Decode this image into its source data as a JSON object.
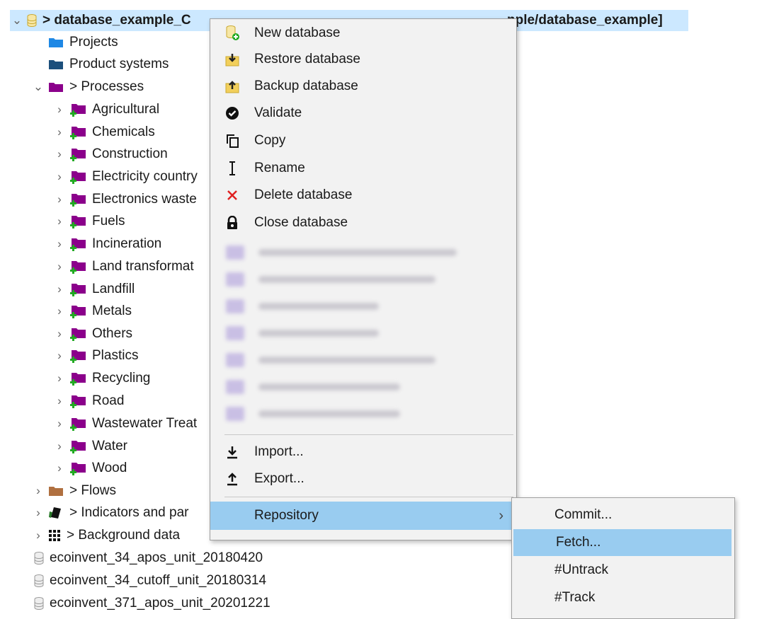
{
  "tree": {
    "root_label": "> database_example_C",
    "root_label_suffix": "nple/database_example]",
    "projects": "Projects",
    "product_systems": "Product systems",
    "processes": "> Processes",
    "process_folders": [
      "Agricultural",
      "Chemicals",
      "Construction",
      "Electricity country",
      "Electronics waste",
      "Fuels",
      "Incineration",
      "Land transformat",
      "Landfill",
      "Metals",
      "Others",
      "Plastics",
      "Recycling",
      "Road",
      "Wastewater Treat",
      "Water",
      "Wood"
    ],
    "flows": "> Flows",
    "indicators": "> Indicators and par",
    "background": "> Background data",
    "databases": [
      "ecoinvent_34_apos_unit_20180420",
      "ecoinvent_34_cutoff_unit_20180314",
      "ecoinvent_371_apos_unit_20201221"
    ]
  },
  "context_menu": {
    "items": [
      {
        "label": "New database",
        "icon": "new-database-icon"
      },
      {
        "label": "Restore database",
        "icon": "restore-icon"
      },
      {
        "label": "Backup database",
        "icon": "backup-icon"
      },
      {
        "label": "Validate",
        "icon": "check-circle-icon"
      },
      {
        "label": "Copy",
        "icon": "copy-icon"
      },
      {
        "label": "Rename",
        "icon": "text-cursor-icon"
      },
      {
        "label": "Delete database",
        "icon": "delete-x-icon"
      },
      {
        "label": "Close database",
        "icon": "lock-icon"
      }
    ],
    "import": "Import...",
    "export": "Export...",
    "repository": "Repository"
  },
  "repository_submenu": {
    "items": [
      "Commit...",
      "Fetch...",
      "#Untrack",
      "#Track"
    ],
    "highlighted": "Fetch..."
  },
  "colors": {
    "selection": "#cce8ff",
    "menu_highlight": "#99ccf0",
    "process_folder": "#8b008b",
    "process_plus": "#22aa22",
    "folder_blue": "#1e88e5",
    "folder_dark_blue": "#1c4f7c",
    "flows_folder": "#b07040"
  }
}
